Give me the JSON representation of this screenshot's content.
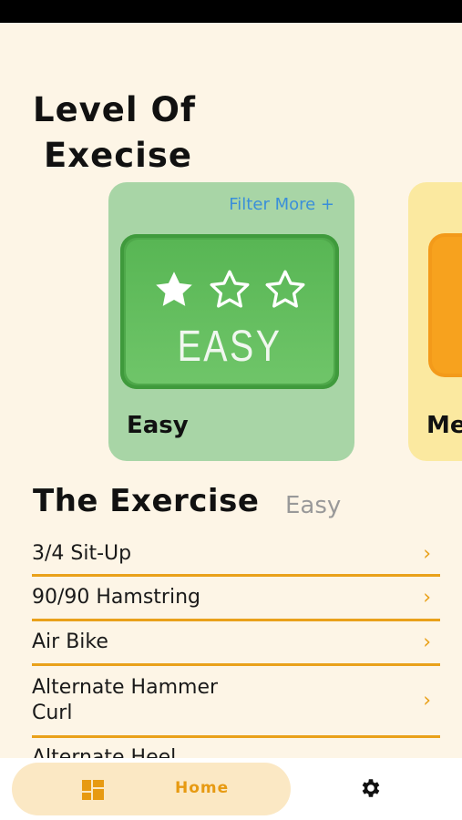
{
  "title": {
    "line1": "Level Of",
    "line2": "Execise"
  },
  "levels": [
    {
      "label": "Easy",
      "filter_more": "Filter More +",
      "badge_text": "EASY",
      "stars_filled": 1,
      "stars_total": 3,
      "color": "#a8d5a6"
    },
    {
      "label": "Me",
      "color": "#fbe9a0"
    }
  ],
  "exercise_section": {
    "title": "The Exercise",
    "filter": "Easy"
  },
  "exercises": [
    {
      "name": "3/4 Sit-Up"
    },
    {
      "name": "90/90 Hamstring"
    },
    {
      "name": "Air Bike"
    },
    {
      "name": "Alternate Hammer Curl"
    },
    {
      "name": "Alternate Heel"
    }
  ],
  "chevron": "›",
  "bottom_nav": {
    "home_label": "Home",
    "home_icon": "dashboard-icon",
    "settings_icon": "gear-icon",
    "accent": "#e79a12"
  }
}
